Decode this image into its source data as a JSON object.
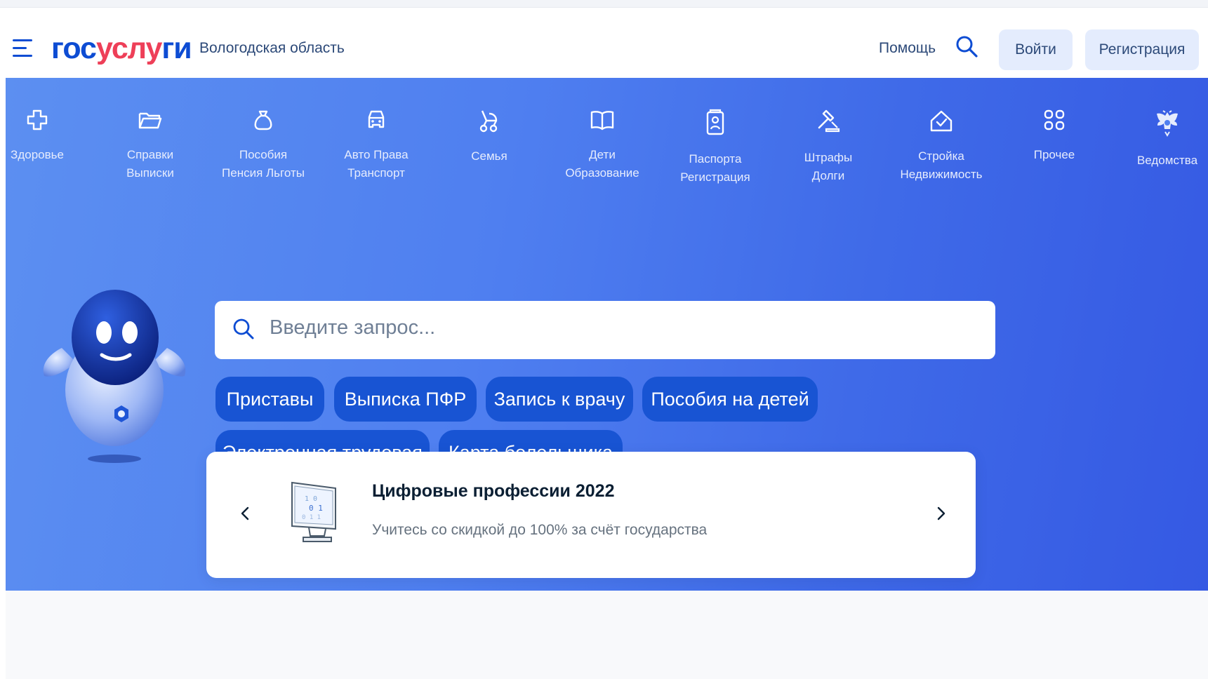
{
  "header": {
    "menu_icon": "hamburger-icon",
    "logo": {
      "part1": "гос",
      "part2": "услу",
      "part3": "ги"
    },
    "region": "Вологодская область",
    "help": "Помощь",
    "search_icon": "search-icon",
    "login": "Войти",
    "register": "Регистрация",
    "colors": {
      "brand_blue": "#0d4cd3",
      "brand_red": "#ee3f58"
    }
  },
  "categories": [
    {
      "icon": "plus-cross-icon",
      "line1": "Здоровье",
      "line2": ""
    },
    {
      "icon": "folder-icon",
      "line1": "Справки",
      "line2": "Выписки"
    },
    {
      "icon": "money-bag-icon",
      "line1": "Пособия",
      "line2": "Пенсия Льготы"
    },
    {
      "icon": "car-icon",
      "line1": "Авто Права",
      "line2": "Транспорт"
    },
    {
      "icon": "stroller-icon",
      "line1": "Семья",
      "line2": ""
    },
    {
      "icon": "book-icon",
      "line1": "Дети",
      "line2": "Образование"
    },
    {
      "icon": "passport-icon",
      "line1": "Паспорта",
      "line2": "Регистрация"
    },
    {
      "icon": "gavel-icon",
      "line1": "Штрафы",
      "line2": "Долги"
    },
    {
      "icon": "house-check-icon",
      "line1": "Стройка",
      "line2": "Недвижимость"
    },
    {
      "icon": "grid-icon",
      "line1": "Прочее",
      "line2": ""
    },
    {
      "icon": "coat-of-arms-icon",
      "line1": "Ведомства",
      "line2": ""
    }
  ],
  "search": {
    "placeholder": "Введите запрос..."
  },
  "quick_links": [
    "Приставы",
    "Выписка ПФР",
    "Запись к врачу",
    "Пособия на детей",
    "Электронная трудовая",
    "Карта болельщика"
  ],
  "promo": {
    "title": "Цифровые профессии 2022",
    "subtitle": "Учитесь со скидкой до 100% за счёт государства",
    "prev": "‹",
    "next": "›"
  },
  "colors": {
    "hero_blue": "#4f7ff0",
    "chip_blue": "#1854d3"
  }
}
